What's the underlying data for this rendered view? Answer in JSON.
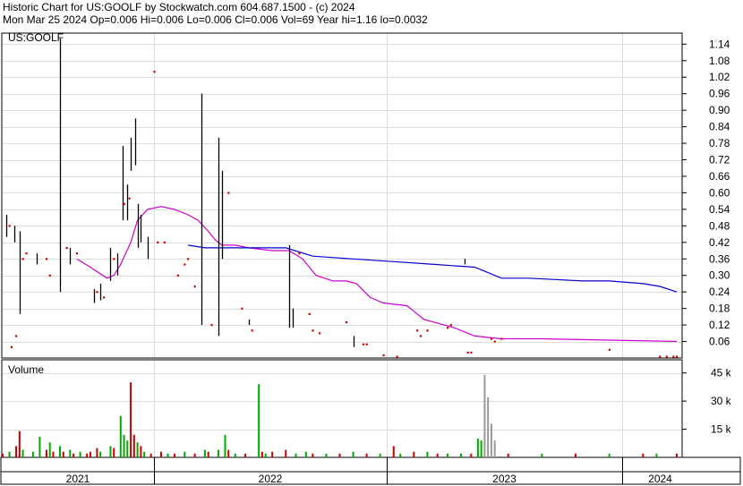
{
  "header": {
    "line1": "Historic Chart for US:GOOLF by Stockwatch.com 604.687.1500 - (c) 2024",
    "line2": "Mon Mar 25 2024   Op=0.006  Hi=0.006  Lo=0.006  Cl=0.006  Vol=69  Year hi=1.16  lo=0.0032"
  },
  "chart_data": [
    {
      "type": "line",
      "title": "US:GOOLF",
      "x_axis": {
        "labels": [
          "2021",
          "2022",
          "2023",
          "2024"
        ]
      },
      "y_axis": {
        "ticks": [
          "0.06",
          "0.12",
          "0.18",
          "0.24",
          "0.30",
          "0.36",
          "0.42",
          "0.48",
          "0.54",
          "0.60",
          "0.66",
          "0.72",
          "0.78",
          "0.84",
          "0.90",
          "0.96",
          "1.02",
          "1.08",
          "1.14"
        ],
        "range": [
          0,
          1.18
        ],
        "side": "right"
      },
      "grid": true,
      "colors": {
        "price_bars": "#000000",
        "price_dots": "#cc0000",
        "fast_ma": "#cc00cc",
        "slow_ma": "#0000cc"
      },
      "price_ranges": [
        {
          "x": 0.005,
          "lo": 0.44,
          "hi": 0.52
        },
        {
          "x": 0.017,
          "lo": 0.42,
          "hi": 0.48
        },
        {
          "x": 0.025,
          "lo": 0.16,
          "hi": 0.46
        },
        {
          "x": 0.05,
          "lo": 0.34,
          "hi": 0.38
        },
        {
          "x": 0.085,
          "lo": 0.24,
          "hi": 1.16
        },
        {
          "x": 0.1,
          "lo": 0.34,
          "hi": 0.4
        },
        {
          "x": 0.135,
          "lo": 0.2,
          "hi": 0.25
        },
        {
          "x": 0.145,
          "lo": 0.21,
          "hi": 0.27
        },
        {
          "x": 0.16,
          "lo": 0.28,
          "hi": 0.4
        },
        {
          "x": 0.17,
          "lo": 0.3,
          "hi": 0.38
        },
        {
          "x": 0.178,
          "lo": 0.5,
          "hi": 0.77
        },
        {
          "x": 0.184,
          "lo": 0.5,
          "hi": 0.63
        },
        {
          "x": 0.19,
          "lo": 0.68,
          "hi": 0.8
        },
        {
          "x": 0.196,
          "lo": 0.7,
          "hi": 0.87
        },
        {
          "x": 0.2,
          "lo": 0.4,
          "hi": 0.56
        },
        {
          "x": 0.205,
          "lo": 0.42,
          "hi": 0.52
        },
        {
          "x": 0.215,
          "lo": 0.36,
          "hi": 0.44
        },
        {
          "x": 0.295,
          "lo": 0.12,
          "hi": 0.96
        },
        {
          "x": 0.32,
          "lo": 0.08,
          "hi": 0.8
        },
        {
          "x": 0.325,
          "lo": 0.36,
          "hi": 0.68
        },
        {
          "x": 0.365,
          "lo": 0.12,
          "hi": 0.14
        },
        {
          "x": 0.425,
          "lo": 0.11,
          "hi": 0.41
        },
        {
          "x": 0.43,
          "lo": 0.11,
          "hi": 0.18
        },
        {
          "x": 0.52,
          "lo": 0.04,
          "hi": 0.08
        },
        {
          "x": 0.685,
          "lo": 0.34,
          "hi": 0.36
        }
      ],
      "price_points": [
        {
          "x": 0.01,
          "y": 0.48
        },
        {
          "x": 0.013,
          "y": 0.04
        },
        {
          "x": 0.02,
          "y": 0.08
        },
        {
          "x": 0.03,
          "y": 0.36
        },
        {
          "x": 0.035,
          "y": 0.38
        },
        {
          "x": 0.065,
          "y": 0.36
        },
        {
          "x": 0.07,
          "y": 0.3
        },
        {
          "x": 0.095,
          "y": 0.4
        },
        {
          "x": 0.11,
          "y": 0.38
        },
        {
          "x": 0.14,
          "y": 0.24
        },
        {
          "x": 0.15,
          "y": 0.22
        },
        {
          "x": 0.165,
          "y": 0.36
        },
        {
          "x": 0.18,
          "y": 0.56
        },
        {
          "x": 0.188,
          "y": 0.58
        },
        {
          "x": 0.225,
          "y": 1.04
        },
        {
          "x": 0.23,
          "y": 0.42
        },
        {
          "x": 0.24,
          "y": 0.42
        },
        {
          "x": 0.26,
          "y": 0.3
        },
        {
          "x": 0.27,
          "y": 0.34
        },
        {
          "x": 0.275,
          "y": 0.36
        },
        {
          "x": 0.285,
          "y": 0.26
        },
        {
          "x": 0.31,
          "y": 0.12
        },
        {
          "x": 0.335,
          "y": 0.6
        },
        {
          "x": 0.355,
          "y": 0.18
        },
        {
          "x": 0.37,
          "y": 0.1
        },
        {
          "x": 0.44,
          "y": 0.38
        },
        {
          "x": 0.455,
          "y": 0.16
        },
        {
          "x": 0.46,
          "y": 0.1
        },
        {
          "x": 0.47,
          "y": 0.09
        },
        {
          "x": 0.51,
          "y": 0.13
        },
        {
          "x": 0.535,
          "y": 0.05
        },
        {
          "x": 0.54,
          "y": 0.05
        },
        {
          "x": 0.565,
          "y": 0.01
        },
        {
          "x": 0.585,
          "y": 0.005
        },
        {
          "x": 0.615,
          "y": 0.1
        },
        {
          "x": 0.62,
          "y": 0.08
        },
        {
          "x": 0.63,
          "y": 0.1
        },
        {
          "x": 0.66,
          "y": 0.11
        },
        {
          "x": 0.665,
          "y": 0.12
        },
        {
          "x": 0.69,
          "y": 0.02
        },
        {
          "x": 0.695,
          "y": 0.02
        },
        {
          "x": 0.725,
          "y": 0.07
        },
        {
          "x": 0.73,
          "y": 0.06
        },
        {
          "x": 0.74,
          "y": 0.07
        },
        {
          "x": 0.9,
          "y": 0.03
        },
        {
          "x": 0.975,
          "y": 0.005
        },
        {
          "x": 0.985,
          "y": 0.005
        },
        {
          "x": 0.995,
          "y": 0.005
        },
        {
          "x": 1.0,
          "y": 0.005
        }
      ],
      "series": [
        {
          "key": "fast_ma",
          "points": [
            [
              0.11,
              0.36
            ],
            [
              0.13,
              0.33
            ],
            [
              0.155,
              0.29
            ],
            [
              0.165,
              0.3
            ],
            [
              0.175,
              0.34
            ],
            [
              0.19,
              0.42
            ],
            [
              0.2,
              0.5
            ],
            [
              0.215,
              0.54
            ],
            [
              0.235,
              0.55
            ],
            [
              0.255,
              0.54
            ],
            [
              0.275,
              0.52
            ],
            [
              0.29,
              0.5
            ],
            [
              0.305,
              0.46
            ],
            [
              0.315,
              0.43
            ],
            [
              0.325,
              0.41
            ],
            [
              0.345,
              0.41
            ],
            [
              0.365,
              0.4
            ],
            [
              0.4,
              0.39
            ],
            [
              0.425,
              0.39
            ],
            [
              0.445,
              0.36
            ],
            [
              0.465,
              0.3
            ],
            [
              0.49,
              0.28
            ],
            [
              0.51,
              0.28
            ],
            [
              0.525,
              0.27
            ],
            [
              0.545,
              0.22
            ],
            [
              0.565,
              0.2
            ],
            [
              0.6,
              0.19
            ],
            [
              0.61,
              0.17
            ],
            [
              0.625,
              0.14
            ],
            [
              0.655,
              0.12
            ],
            [
              0.67,
              0.11
            ],
            [
              0.7,
              0.08
            ],
            [
              0.74,
              0.07
            ],
            [
              0.8,
              0.07
            ],
            [
              0.9,
              0.065
            ],
            [
              1.0,
              0.06
            ]
          ]
        },
        {
          "key": "slow_ma",
          "points": [
            [
              0.275,
              0.41
            ],
            [
              0.3,
              0.4
            ],
            [
              0.33,
              0.4
            ],
            [
              0.36,
              0.4
            ],
            [
              0.42,
              0.4
            ],
            [
              0.46,
              0.37
            ],
            [
              0.52,
              0.36
            ],
            [
              0.58,
              0.35
            ],
            [
              0.64,
              0.34
            ],
            [
              0.7,
              0.33
            ],
            [
              0.72,
              0.31
            ],
            [
              0.74,
              0.29
            ],
            [
              0.78,
              0.29
            ],
            [
              0.82,
              0.285
            ],
            [
              0.86,
              0.28
            ],
            [
              0.9,
              0.28
            ],
            [
              0.95,
              0.27
            ],
            [
              0.975,
              0.26
            ],
            [
              1.0,
              0.24
            ]
          ]
        }
      ]
    },
    {
      "type": "bar",
      "title": "Volume",
      "y_axis": {
        "ticks": [
          "15 k",
          "30 k",
          "45 k"
        ],
        "range": [
          0,
          52
        ],
        "unit": "thousands"
      },
      "colors": {
        "up": "#00aa00",
        "down": "#cc0000",
        "flat": "#999999"
      },
      "bars": [
        {
          "x": 0.0,
          "v": 2,
          "c": "down"
        },
        {
          "x": 0.01,
          "v": 3,
          "c": "up"
        },
        {
          "x": 0.02,
          "v": 6,
          "c": "down"
        },
        {
          "x": 0.025,
          "v": 14,
          "c": "down"
        },
        {
          "x": 0.03,
          "v": 4,
          "c": "up"
        },
        {
          "x": 0.045,
          "v": 3,
          "c": "up"
        },
        {
          "x": 0.055,
          "v": 11,
          "c": "up"
        },
        {
          "x": 0.065,
          "v": 4,
          "c": "down"
        },
        {
          "x": 0.07,
          "v": 8,
          "c": "up"
        },
        {
          "x": 0.075,
          "v": 3,
          "c": "down"
        },
        {
          "x": 0.085,
          "v": 6,
          "c": "up"
        },
        {
          "x": 0.09,
          "v": 3,
          "c": "down"
        },
        {
          "x": 0.1,
          "v": 4,
          "c": "up"
        },
        {
          "x": 0.105,
          "v": 2,
          "c": "down"
        },
        {
          "x": 0.115,
          "v": 3,
          "c": "up"
        },
        {
          "x": 0.125,
          "v": 2,
          "c": "down"
        },
        {
          "x": 0.13,
          "v": 3,
          "c": "down"
        },
        {
          "x": 0.14,
          "v": 5,
          "c": "down"
        },
        {
          "x": 0.145,
          "v": 3,
          "c": "up"
        },
        {
          "x": 0.16,
          "v": 6,
          "c": "up"
        },
        {
          "x": 0.165,
          "v": 5,
          "c": "down"
        },
        {
          "x": 0.175,
          "v": 22,
          "c": "up"
        },
        {
          "x": 0.18,
          "v": 12,
          "c": "up"
        },
        {
          "x": 0.185,
          "v": 9,
          "c": "up"
        },
        {
          "x": 0.19,
          "v": 40,
          "c": "down"
        },
        {
          "x": 0.195,
          "v": 12,
          "c": "down"
        },
        {
          "x": 0.2,
          "v": 8,
          "c": "up"
        },
        {
          "x": 0.205,
          "v": 6,
          "c": "down"
        },
        {
          "x": 0.21,
          "v": 3,
          "c": "up"
        },
        {
          "x": 0.22,
          "v": 2,
          "c": "down"
        },
        {
          "x": 0.235,
          "v": 3,
          "c": "down"
        },
        {
          "x": 0.245,
          "v": 2,
          "c": "up"
        },
        {
          "x": 0.255,
          "v": 2,
          "c": "down"
        },
        {
          "x": 0.27,
          "v": 3,
          "c": "up"
        },
        {
          "x": 0.285,
          "v": 2,
          "c": "down"
        },
        {
          "x": 0.3,
          "v": 4,
          "c": "up"
        },
        {
          "x": 0.305,
          "v": 3,
          "c": "down"
        },
        {
          "x": 0.32,
          "v": 4,
          "c": "up"
        },
        {
          "x": 0.33,
          "v": 12,
          "c": "up"
        },
        {
          "x": 0.335,
          "v": 4,
          "c": "down"
        },
        {
          "x": 0.345,
          "v": 2,
          "c": "up"
        },
        {
          "x": 0.36,
          "v": 2,
          "c": "down"
        },
        {
          "x": 0.38,
          "v": 39,
          "c": "up"
        },
        {
          "x": 0.385,
          "v": 3,
          "c": "down"
        },
        {
          "x": 0.39,
          "v": 2,
          "c": "up"
        },
        {
          "x": 0.4,
          "v": 3,
          "c": "down"
        },
        {
          "x": 0.42,
          "v": 4,
          "c": "down"
        },
        {
          "x": 0.435,
          "v": 2,
          "c": "up"
        },
        {
          "x": 0.45,
          "v": 3,
          "c": "up"
        },
        {
          "x": 0.46,
          "v": 2,
          "c": "down"
        },
        {
          "x": 0.48,
          "v": 2,
          "c": "up"
        },
        {
          "x": 0.5,
          "v": 2,
          "c": "down"
        },
        {
          "x": 0.52,
          "v": 3,
          "c": "up"
        },
        {
          "x": 0.54,
          "v": 2,
          "c": "down"
        },
        {
          "x": 0.56,
          "v": 2,
          "c": "up"
        },
        {
          "x": 0.58,
          "v": 6,
          "c": "down"
        },
        {
          "x": 0.59,
          "v": 2,
          "c": "up"
        },
        {
          "x": 0.61,
          "v": 3,
          "c": "down"
        },
        {
          "x": 0.63,
          "v": 3,
          "c": "up"
        },
        {
          "x": 0.645,
          "v": 2,
          "c": "down"
        },
        {
          "x": 0.66,
          "v": 2,
          "c": "up"
        },
        {
          "x": 0.68,
          "v": 2,
          "c": "up"
        },
        {
          "x": 0.695,
          "v": 2,
          "c": "down"
        },
        {
          "x": 0.705,
          "v": 10,
          "c": "up"
        },
        {
          "x": 0.71,
          "v": 9,
          "c": "up"
        },
        {
          "x": 0.715,
          "v": 44,
          "c": "flat"
        },
        {
          "x": 0.72,
          "v": 32,
          "c": "flat"
        },
        {
          "x": 0.725,
          "v": 18,
          "c": "flat"
        },
        {
          "x": 0.73,
          "v": 9,
          "c": "flat"
        },
        {
          "x": 0.75,
          "v": 2,
          "c": "down"
        },
        {
          "x": 0.8,
          "v": 2,
          "c": "up"
        },
        {
          "x": 0.85,
          "v": 2,
          "c": "down"
        },
        {
          "x": 0.9,
          "v": 2,
          "c": "up"
        },
        {
          "x": 0.95,
          "v": 2,
          "c": "down"
        },
        {
          "x": 0.97,
          "v": 2,
          "c": "up"
        },
        {
          "x": 1.0,
          "v": 2,
          "c": "down"
        }
      ]
    }
  ]
}
